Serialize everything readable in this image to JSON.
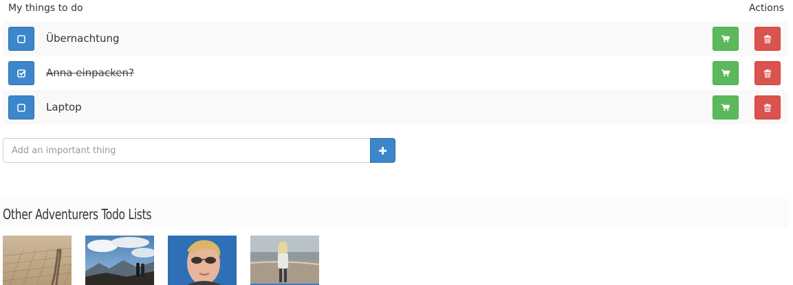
{
  "header": {
    "title": "My things to do",
    "actions_label": "Actions"
  },
  "todos": [
    {
      "text": "Übernachtung",
      "done": false
    },
    {
      "text": "Anna einpacken?",
      "done": true
    },
    {
      "text": "Laptop",
      "done": false
    }
  ],
  "add_form": {
    "placeholder": "Add an important thing"
  },
  "others": {
    "title": "Other Adventurers Todo Lists",
    "avatars": [
      "desert-shadow-photo",
      "mountain-couple-photo",
      "man-sunglasses-photo",
      "woman-beach-photo"
    ]
  },
  "colors": {
    "primary": "#3c87cb",
    "success": "#5cb85c",
    "danger": "#d9534f"
  }
}
